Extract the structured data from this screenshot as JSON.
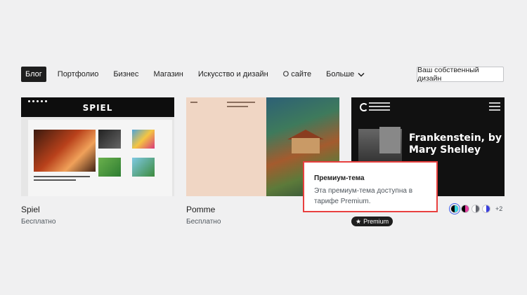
{
  "nav": {
    "items": [
      {
        "label": "Блог",
        "active": true
      },
      {
        "label": "Портфолио"
      },
      {
        "label": "Бизнес"
      },
      {
        "label": "Магазин"
      },
      {
        "label": "Искусство и дизайн"
      },
      {
        "label": "О сайте"
      },
      {
        "label": "Больше",
        "icon": "chevron-down-icon"
      }
    ],
    "design_button": "Ваш собственный дизайн"
  },
  "themes": [
    {
      "name": "Spiel",
      "price": "Бесплатно",
      "thumb_logo": "SPIEL"
    },
    {
      "name": "Pomme",
      "price": "Бесплатно"
    },
    {
      "name": "",
      "badge": "Premium",
      "thumb_title_1": "Frankenstein, by",
      "thumb_title_2": "Mary Shelley"
    }
  ],
  "swatches": {
    "colors": [
      {
        "left": "#000000",
        "right": "#35d6e0",
        "selected": true
      },
      {
        "left": "#000000",
        "right": "#e43fa0"
      },
      {
        "left": "#ffffff",
        "right": "#62646c"
      },
      {
        "left": "#ffffff",
        "right": "#3a3fdb"
      }
    ],
    "more": "+2"
  },
  "tooltip": {
    "title": "Премиум-тема",
    "text": "Эта премиум-тема доступна в тарифе Premium."
  },
  "colors": {
    "accent": "#3858e9",
    "highlight_border": "#e8403f"
  }
}
